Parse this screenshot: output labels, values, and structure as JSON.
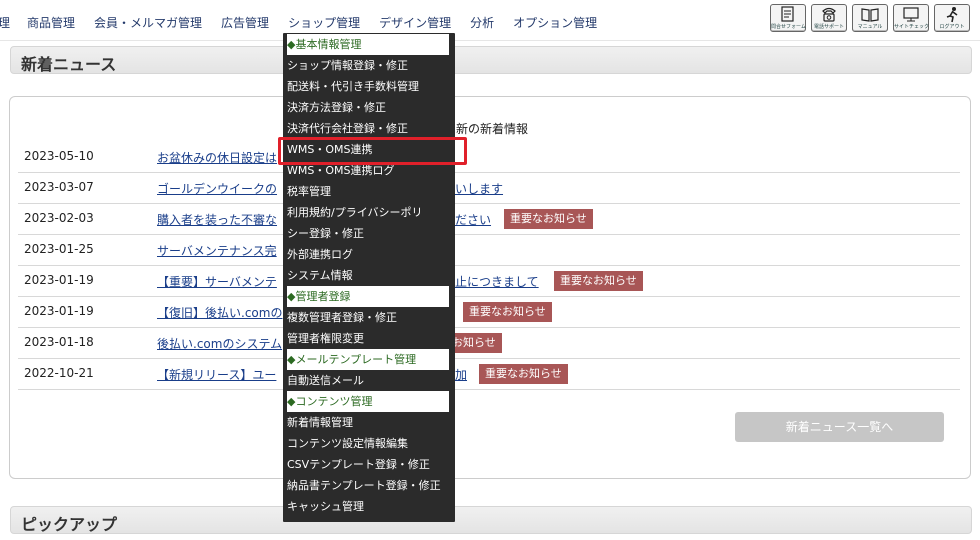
{
  "nav": {
    "items": [
      "理",
      "商品管理",
      "会員・メルマガ管理",
      "広告管理",
      "ショップ管理",
      "デザイン管理",
      "分析",
      "オプション管理"
    ],
    "icons": [
      {
        "name": "inquiry-form-icon",
        "label": "問合せフォーム"
      },
      {
        "name": "phone-support-icon",
        "label": "電話サポート"
      },
      {
        "name": "manual-icon",
        "label": "マニュアル"
      },
      {
        "name": "site-check-icon",
        "label": "サイトチェック"
      },
      {
        "name": "logout-icon",
        "label": "ログアウト"
      }
    ]
  },
  "news": {
    "section_title": "新着ニュース",
    "caption": "新の新着情報",
    "items": [
      {
        "date": "2023-05-10",
        "title": "お盆休みの休日設定は",
        "badge": ""
      },
      {
        "date": "2023-03-07",
        "title": "ゴールデンウイークの",
        "title_tail": "いします",
        "badge": ""
      },
      {
        "date": "2023-02-03",
        "title": "購入者を装った不審な",
        "title_tail": "ださい",
        "badge": "重要なお知らせ"
      },
      {
        "date": "2023-01-25",
        "title": "サーバメンテナンス完",
        "badge": ""
      },
      {
        "date": "2023-01-19",
        "title": "【重要】サーバメンテ",
        "title_tail": "止につきまして",
        "badge": "重要なお知らせ"
      },
      {
        "date": "2023-01-19",
        "title": "【復旧】後払い.comの",
        "badge": "重要なお知らせ"
      },
      {
        "date": "2023-01-18",
        "title": "後払い.comのシステム",
        "badge": "お知らせ"
      },
      {
        "date": "2022-10-21",
        "title": "【新規リリース】ユー",
        "title_tail": "加",
        "badge": "重要なお知らせ"
      }
    ],
    "more_button": "新着ニュース一覧へ"
  },
  "pickup": {
    "section_title": "ピックアップ"
  },
  "dropdown": {
    "items": [
      {
        "text": "◆基本情報管理",
        "kind": "cat"
      },
      {
        "text": "ショップ情報登録・修正",
        "kind": "link"
      },
      {
        "text": "配送料・代引き手数料管理",
        "kind": "link"
      },
      {
        "text": "決済方法登録・修正",
        "kind": "link"
      },
      {
        "text": "決済代行会社登録・修正",
        "kind": "link"
      },
      {
        "text": "WMS・OMS連携",
        "kind": "link"
      },
      {
        "text": "WMS・OMS連携ログ",
        "kind": "link"
      },
      {
        "text": "税率管理",
        "kind": "link"
      },
      {
        "text": "利用規約/プライバシーポリ",
        "kind": "link"
      },
      {
        "text": "シー登録・修正",
        "kind": "link"
      },
      {
        "text": "外部連携ログ",
        "kind": "link"
      },
      {
        "text": "システム情報",
        "kind": "link"
      },
      {
        "text": "◆管理者登録",
        "kind": "cat"
      },
      {
        "text": "複数管理者登録・修正",
        "kind": "link"
      },
      {
        "text": "管理者権限変更",
        "kind": "link"
      },
      {
        "text": "◆メールテンプレート管理",
        "kind": "cat"
      },
      {
        "text": "自動送信メール",
        "kind": "link"
      },
      {
        "text": "◆コンテンツ管理",
        "kind": "cat"
      },
      {
        "text": "新着情報管理",
        "kind": "link"
      },
      {
        "text": "コンテンツ設定情報編集",
        "kind": "link"
      },
      {
        "text": "CSVテンプレート登録・修正",
        "kind": "link"
      },
      {
        "text": "納品書テンプレート登録・修正",
        "kind": "link"
      },
      {
        "text": "キャッシュ管理",
        "kind": "link"
      }
    ]
  }
}
